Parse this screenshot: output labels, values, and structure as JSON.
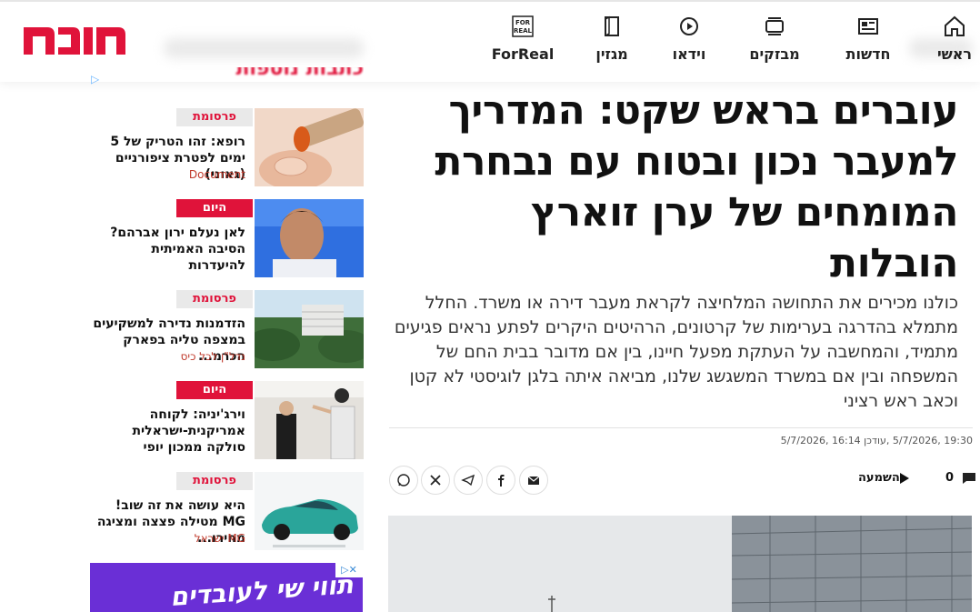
{
  "header": {
    "logo_alt": "היום",
    "nav": [
      {
        "label": "ראשי",
        "icon": "home-icon"
      },
      {
        "label": "חדשות",
        "icon": "newspaper-icon"
      },
      {
        "label": "מבזקים",
        "icon": "flash-news-icon"
      },
      {
        "label": "וידאו",
        "icon": "video-icon"
      },
      {
        "label": "מגזין",
        "icon": "magazine-icon"
      },
      {
        "label": "ForReal",
        "icon": "forreal-icon",
        "icon_text": "FOR REAL"
      }
    ]
  },
  "sidebar": {
    "heading": "כתבות נוספות",
    "cards": [
      {
        "tag": "פרסומת",
        "tag_type": "promo",
        "title": "רופא: זהו הטריק של 5 ימים לפטרת ציפורניים (גאוני)",
        "source": "Document"
      },
      {
        "tag": "היום",
        "tag_type": "hayom",
        "title": "לאן נעלם ירון אברהם? הסיבה האמיתית להיעדרות",
        "source": ""
      },
      {
        "tag": "פרסומת",
        "tag_type": "promo",
        "title": "הזדמנות נדירה למשקיעים במצפה טליה בפארק הכרמ...",
        "source": "נדל\"ן לכל כיס"
      },
      {
        "tag": "היום",
        "tag_type": "hayom",
        "title": "וירג'יניה: לקוחה אמריקנית-ישראלית סולקה ממכון יופי",
        "source": ""
      },
      {
        "tag": "פרסומת",
        "tag_type": "promo",
        "title": "היא עושה את זה שוב! MG מטילה פצצה ומציגה מחירו...",
        "source": "MG ישראל"
      }
    ],
    "banner_text": "תווי שי לעובדים"
  },
  "article": {
    "headline": "עוברים בראש שקט: המדריך למעבר נכון ובטוח עם נבחרת המומחים של ערן זוארץ הובלות",
    "lead": "כולנו מכירים את התחושה המלחיצה לקראת מעבר דירה או משרד. החלל מתמלא בהדרגה בערימות של קרטונים, הרהיטים היקרים לפתע נראים פגיעים מתמיד, והמחשבה על העתקת מפעל חיינו, בין אם מדובר בבית החם של המשפחה ובין אם במשרד המשגשג שלנו, מביאה איתה בלגן לוגיסטי לא קטן וכאב ראש רציני",
    "dates": "19:30 ,5/7/2026 ,עודכן 16:14 ,5/7/2026",
    "listen_label": "השמעה",
    "comments_count": "0"
  }
}
